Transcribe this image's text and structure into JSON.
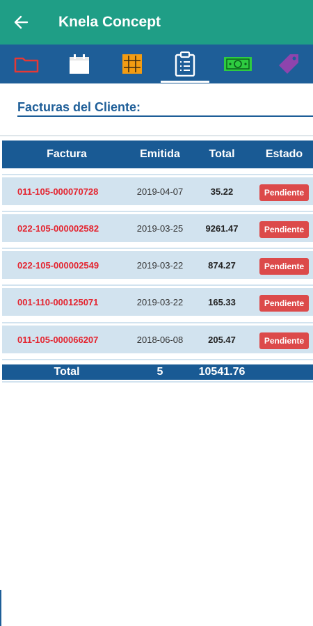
{
  "appbar": {
    "title": "Knela Concept",
    "back_icon": "arrow-left-icon"
  },
  "tabs": [
    {
      "name": "folder",
      "icon": "folder-icon",
      "color": "#e53935"
    },
    {
      "name": "calendar",
      "icon": "calendar-icon",
      "color": "#ffffff"
    },
    {
      "name": "grid",
      "icon": "grid-icon",
      "color": "#f39c12"
    },
    {
      "name": "clipboard",
      "icon": "clipboard-icon",
      "color": "#ffffff",
      "active": true
    },
    {
      "name": "cash",
      "icon": "cash-icon",
      "color": "#2ecc40"
    },
    {
      "name": "tag",
      "icon": "tag-icon",
      "color": "#8e44ad"
    }
  ],
  "section": {
    "title": "Facturas del Cliente:"
  },
  "table": {
    "headers": {
      "factura": "Factura",
      "emitida": "Emitida",
      "total": "Total",
      "estado": "Estado"
    },
    "rows": [
      {
        "factura": "011-105-000070728",
        "emitida": "2019-04-07",
        "total": "35.22",
        "estado": "Pendiente"
      },
      {
        "factura": "022-105-000002582",
        "emitida": "2019-03-25",
        "total": "9261.47",
        "estado": "Pendiente"
      },
      {
        "factura": "022-105-000002549",
        "emitida": "2019-03-22",
        "total": "874.27",
        "estado": "Pendiente"
      },
      {
        "factura": "001-110-000125071",
        "emitida": "2019-03-22",
        "total": "165.33",
        "estado": "Pendiente"
      },
      {
        "factura": "011-105-000066207",
        "emitida": "2018-06-08",
        "total": "205.47",
        "estado": "Pendiente"
      }
    ],
    "footer": {
      "label": "Total",
      "count": "5",
      "sum": "10541.76"
    }
  },
  "colors": {
    "appbar": "#1f9e86",
    "tabbar": "#1e5e98",
    "header": "#195a94",
    "row": "#d2e3ef",
    "invoice_text": "#e4242f",
    "badge": "#dc4a4a"
  }
}
